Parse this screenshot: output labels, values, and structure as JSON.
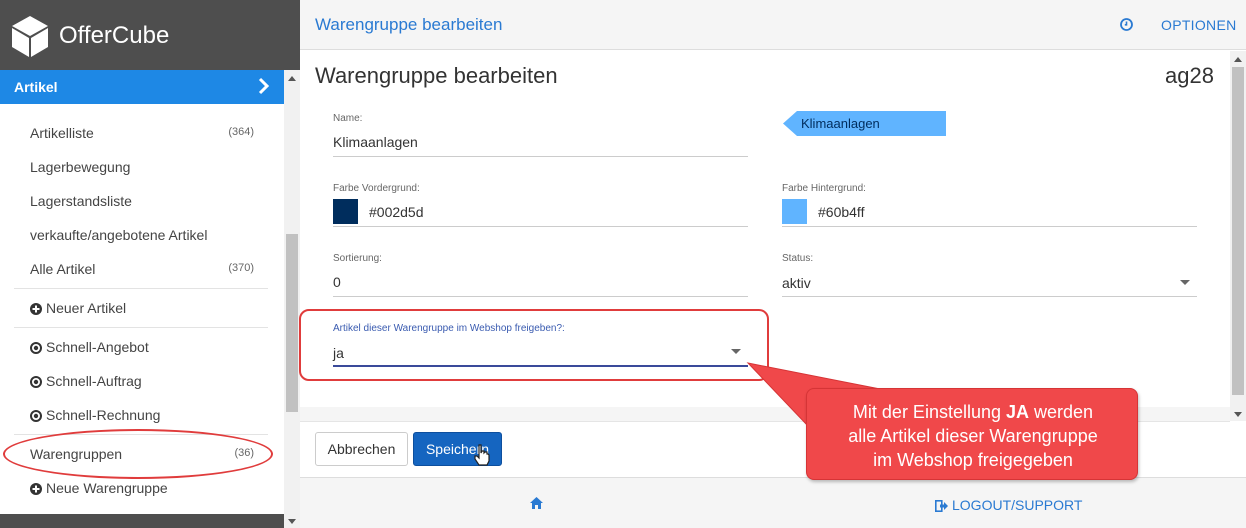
{
  "brand": {
    "name": "OfferCube"
  },
  "sidebar": {
    "section": "Artikel",
    "items": [
      {
        "label": "Artikelliste",
        "count": "(364)"
      },
      {
        "label": "Lagerbewegung",
        "count": ""
      },
      {
        "label": "Lagerstandsliste",
        "count": ""
      },
      {
        "label": "verkaufte/angebotene Artikel",
        "count": ""
      },
      {
        "label": "Alle Artikel",
        "count": "(370)"
      },
      {
        "label": "Neuer Artikel",
        "icon": "plus-circle-icon"
      },
      {
        "label": "Schnell-Angebot",
        "icon": "dot-circle-icon"
      },
      {
        "label": "Schnell-Auftrag",
        "icon": "dot-circle-icon"
      },
      {
        "label": "Schnell-Rechnung",
        "icon": "dot-circle-icon"
      },
      {
        "label": "Warengruppen",
        "count": "(36)"
      },
      {
        "label": "Neue Warengruppe",
        "icon": "plus-circle-icon"
      }
    ]
  },
  "topbar": {
    "title": "Warengruppe bearbeiten",
    "options": "OPTIONEN"
  },
  "form": {
    "heading": "Warengruppe bearbeiten",
    "code": "ag28",
    "name_label": "Name:",
    "name_value": "Klimaanlagen",
    "tag_preview": "Klimaanlagen",
    "fg_label": "Farbe Vordergrund:",
    "fg_value": "#002d5d",
    "bg_label": "Farbe Hintergrund:",
    "bg_value": "#60b4ff",
    "sort_label": "Sortierung:",
    "sort_value": "0",
    "status_label": "Status:",
    "status_value": "aktiv",
    "webshop_label": "Artikel dieser Warengruppe im Webshop freigeben?:",
    "webshop_value": "ja"
  },
  "buttons": {
    "cancel": "Abbrechen",
    "save": "Speichern"
  },
  "footer": {
    "logout": "LOGOUT/SUPPORT"
  },
  "callout": {
    "line1_pre": "Mit der Einstellung ",
    "line1_bold": "JA",
    "line1_post": " werden",
    "line2": "alle Artikel dieser Warengruppe",
    "line3": "im Webshop freigegeben"
  },
  "colors": {
    "accent": "#1e88e5",
    "link": "#2a7ad2",
    "foreground_swatch": "#002d5d",
    "background_swatch": "#60b4ff",
    "annotation_red": "#e03c3c"
  }
}
